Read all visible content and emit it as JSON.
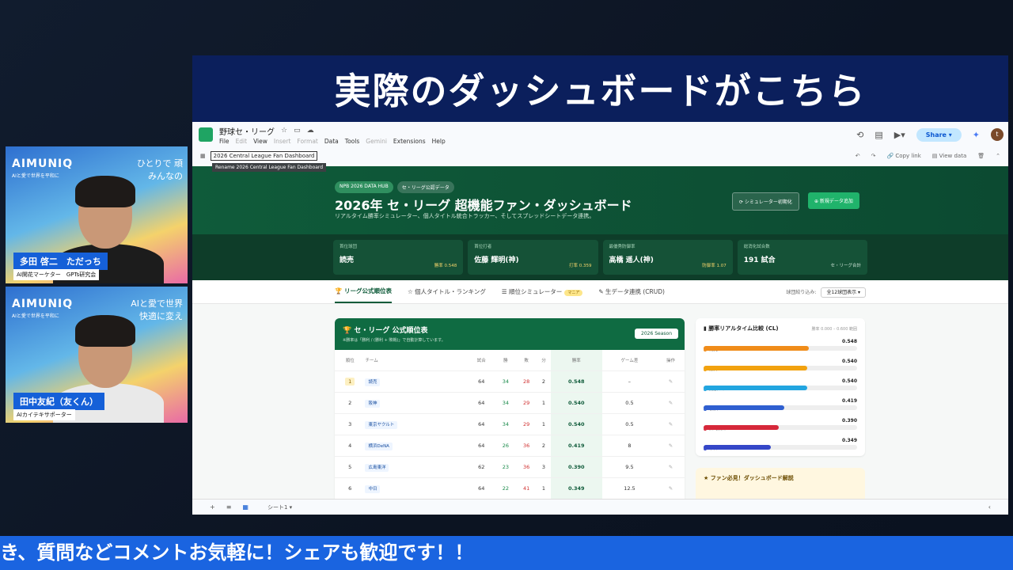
{
  "cam1": {
    "brand": "AIMUNIQ",
    "brand_sub": "AIと愛で世界を平和に",
    "tagline1": "ひとりで 頑",
    "tagline2": "みんなの",
    "name": "多田 啓二　ただっち",
    "role": "AI開花マーケター　GPTs研究会"
  },
  "cam2": {
    "brand": "AIMUNIQ",
    "brand_sub": "AIと愛で世界を平和に",
    "tagline1": "AIと愛で世界",
    "tagline2": "快適に変え",
    "name": "田中友紀（友くん）",
    "role": "AIカイテキサポーター"
  },
  "slide_title": "実際のダッシュボードがこちら",
  "sheets": {
    "doc_title": "野球セ・リーグ",
    "menu": [
      "File",
      "Edit",
      "View",
      "Insert",
      "Format",
      "Data",
      "Tools",
      "Gemini",
      "Extensions",
      "Help"
    ],
    "share": "Share",
    "avatar": "t",
    "name_box": "2026 Central League Fan Dashboard",
    "tooltip": "Rename 2026 Central League Fan Dashboard",
    "copy_link": "Copy link",
    "view_data": "View data",
    "sheet_tab": "シート1"
  },
  "hero": {
    "chip1": "NPB 2026 DATA HUB",
    "chip2": "セ・リーグ公認データ",
    "title": "2026年 セ・リーグ 超機能ファン・ダッシュボード",
    "subtitle": "リアルタイム勝率シミュレーター、個人タイトル統合トラッカー、そしてスプレッドシートデータ連携。",
    "btn_reset": "⟳ シミュレーター初期化",
    "btn_add": "⊕ 新規データ追加"
  },
  "stats": [
    {
      "label": "首位球団",
      "value": "読売",
      "sub": "勝率 0.548"
    },
    {
      "label": "首位打者",
      "value": "佐藤 輝明(神)",
      "sub": "打率 0.359"
    },
    {
      "label": "最優秀防御率",
      "value": "高橋 遥人(神)",
      "sub": "防御率 1.07"
    },
    {
      "label": "総消化試合数",
      "value": "191 試合",
      "sub": "セ・リーグ合計"
    }
  ],
  "tabs": [
    {
      "label": "リーグ公式順位表",
      "badge": ""
    },
    {
      "label": "個人タイトル・ランキング",
      "badge": ""
    },
    {
      "label": "順位シミュレーター",
      "badge": "マニア"
    },
    {
      "label": "生データ連携 (CRUD)",
      "badge": ""
    }
  ],
  "filter": {
    "label": "球団絞り込み:",
    "value": "全12球団表示"
  },
  "standings": {
    "title": "セ・リーグ 公式順位表",
    "subtitle": "※勝率は「勝利 / (勝利 + 敗戦)」で自動計算しています。",
    "season": "2026 Season",
    "headers": [
      "順位",
      "チーム",
      "試合",
      "勝",
      "敗",
      "分",
      "勝率",
      "ゲーム差",
      "操作"
    ],
    "rows": [
      {
        "rank": "1",
        "team": "読売",
        "g": "64",
        "w": "34",
        "l": "28",
        "d": "2",
        "pct": "0.548",
        "gb": "–"
      },
      {
        "rank": "2",
        "team": "阪神",
        "g": "64",
        "w": "34",
        "l": "29",
        "d": "1",
        "pct": "0.540",
        "gb": "0.5"
      },
      {
        "rank": "3",
        "team": "東京ヤクルト",
        "g": "64",
        "w": "34",
        "l": "29",
        "d": "1",
        "pct": "0.540",
        "gb": "0.5"
      },
      {
        "rank": "4",
        "team": "横浜DeNA",
        "g": "64",
        "w": "26",
        "l": "36",
        "d": "2",
        "pct": "0.419",
        "gb": "8"
      },
      {
        "rank": "5",
        "team": "広島東洋",
        "g": "62",
        "w": "23",
        "l": "36",
        "d": "3",
        "pct": "0.390",
        "gb": "9.5"
      },
      {
        "rank": "6",
        "team": "中日",
        "g": "64",
        "w": "22",
        "l": "41",
        "d": "1",
        "pct": "0.349",
        "gb": "12.5"
      }
    ]
  },
  "bars": {
    "title": "勝率リアルタイム比較 (CL)",
    "range": "勝率 0.000 – 0.600 範囲",
    "items": [
      {
        "team": "読売",
        "value": 0.548,
        "label": "0.548",
        "color": "#f08c1a"
      },
      {
        "team": "阪神",
        "value": 0.54,
        "label": "0.540",
        "color": "#f2a20f"
      },
      {
        "team": "東京ヤクルト",
        "value": 0.54,
        "label": "0.540",
        "color": "#22a5e0"
      },
      {
        "team": "横浜DeNA",
        "value": 0.419,
        "label": "0.419",
        "color": "#2f5fd0"
      },
      {
        "team": "広島東洋",
        "value": 0.39,
        "label": "0.390",
        "color": "#d6283a"
      },
      {
        "team": "中日",
        "value": 0.349,
        "label": "0.349",
        "color": "#3547c8"
      }
    ],
    "max": 0.6
  },
  "tip": {
    "title": "★ ファン必見！ダッシュボード解説"
  },
  "ticker": "き、質問などコメントお気軽に！シェアも歓迎です！！"
}
